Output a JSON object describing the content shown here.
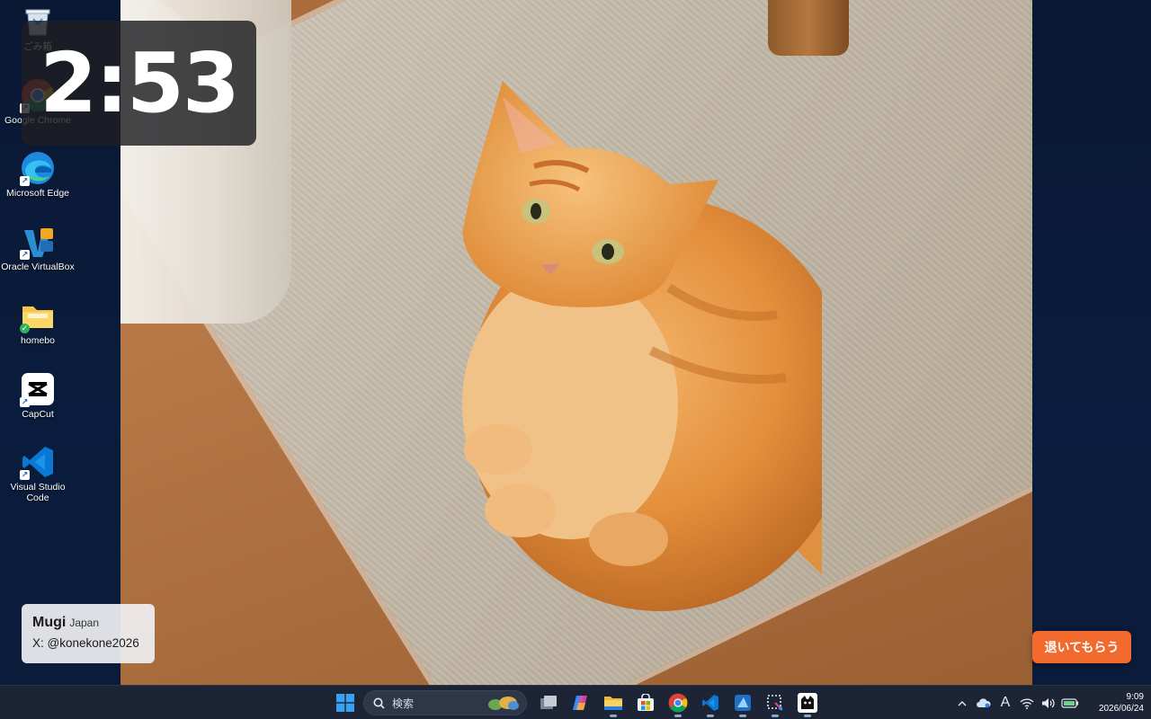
{
  "desktop": {
    "icons": [
      {
        "label": "ごみ箱",
        "icon": "recycle-bin-icon"
      },
      {
        "label": "Google Chrome",
        "icon": "chrome-icon"
      },
      {
        "label": "Microsoft Edge",
        "icon": "edge-icon"
      },
      {
        "label": "Oracle VirtualBox",
        "icon": "virtualbox-icon"
      },
      {
        "label": "homebo",
        "icon": "folder-icon"
      },
      {
        "label": "CapCut",
        "icon": "capcut-icon"
      },
      {
        "label": "Visual Studio Code",
        "icon": "vscode-icon"
      }
    ]
  },
  "clock_widget": {
    "time": "2:53"
  },
  "credit": {
    "name": "Mugi",
    "country": "Japan",
    "handle": "X: @konekone2026"
  },
  "action_button": {
    "label": "退いてもらう",
    "color": "#f26a2e"
  },
  "taskbar": {
    "search_placeholder": "検索",
    "apps": [
      {
        "name": "start-button",
        "icon": "windows-icon"
      },
      {
        "name": "task-view",
        "icon": "task-view-icon"
      },
      {
        "name": "copilot",
        "icon": "copilot-icon"
      },
      {
        "name": "file-explorer",
        "icon": "folder-icon"
      },
      {
        "name": "microsoft-store",
        "icon": "store-icon"
      },
      {
        "name": "chrome",
        "icon": "chrome-icon"
      },
      {
        "name": "vscode",
        "icon": "vscode-icon"
      },
      {
        "name": "azure-data-studio",
        "icon": "azure-icon"
      },
      {
        "name": "snipping-tool",
        "icon": "snipping-icon"
      },
      {
        "name": "cat-app",
        "icon": "cat-icon"
      }
    ],
    "tray": {
      "ime_label": "A",
      "time": "9:09",
      "date": "2026/06/24"
    }
  }
}
